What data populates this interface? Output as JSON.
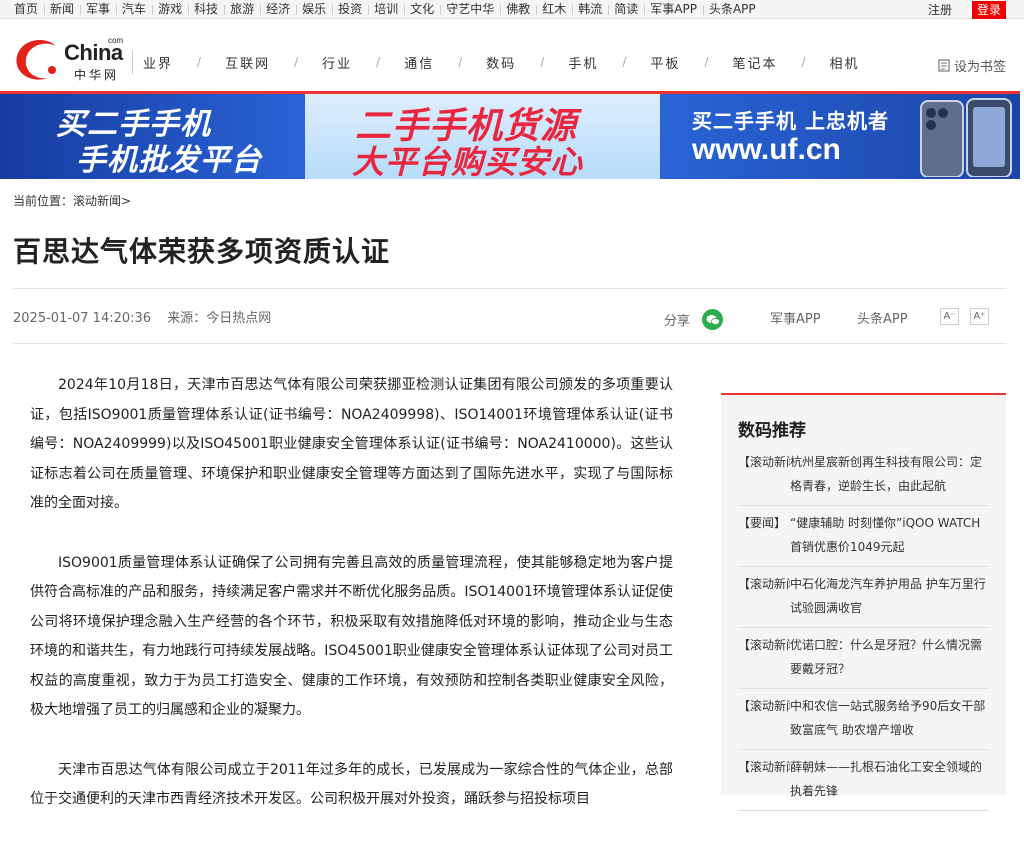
{
  "topbar": {
    "nav": [
      "首页",
      "新闻",
      "军事",
      "汽车",
      "游戏",
      "科技",
      "旅游",
      "经济",
      "娱乐",
      "投资",
      "培训",
      "文化",
      "守艺中华",
      "佛教",
      "红木",
      "韩流",
      "简读",
      "军事APP",
      "头条APP"
    ],
    "register": "注册",
    "login": "登录"
  },
  "header": {
    "logo_text": "China",
    "logo_com": "com",
    "logo_cn": "中华网",
    "nav": [
      "业界",
      "互联网",
      "行业",
      "通信",
      "数码",
      "手机",
      "平板",
      "笔记本",
      "相机"
    ],
    "bookmark": "设为书签"
  },
  "banner": {
    "left_line1": "买二手手机",
    "left_line2": "手机批发平台",
    "mid_line1": "二手手机货源",
    "mid_line2": "大平台购买安心",
    "right_line1": "买二手手机 上忠机者",
    "right_line2": "www.uf.cn"
  },
  "breadcrumb": "当前位置：滚动新闻>",
  "article": {
    "title": "百思达气体荣获多项资质认证",
    "date": "2025-01-07 14:20:36",
    "source": "来源：今日热点网",
    "share_label": "分享",
    "app1": "军事APP",
    "app2": "头条APP",
    "font_minus": "A⁻",
    "font_plus": "A⁺",
    "paragraphs": [
      "2024年10月18日，天津市百思达气体有限公司荣获挪亚检测认证集团有限公司颁发的多项重要认证，包括ISO9001质量管理体系认证(证书编号：NOA2409998)、ISO14001环境管理体系认证(证书编号：NOA2409999)以及ISO45001职业健康安全管理体系认证(证书编号：NOA2410000)。这些认证标志着公司在质量管理、环境保护和职业健康安全管理等方面达到了国际先进水平，实现了与国际标准的全面对接。",
      "ISO9001质量管理体系认证确保了公司拥有完善且高效的质量管理流程，使其能够稳定地为客户提供符合高标准的产品和服务，持续满足客户需求并不断优化服务品质。ISO14001环境管理体系认证促使公司将环境保护理念融入生产经营的各个环节，积极采取有效措施降低对环境的影响，推动企业与生态环境的和谐共生，有力地践行可持续发展战略。ISO45001职业健康安全管理体系认证体现了公司对员工权益的高度重视，致力于为员工打造安全、健康的工作环境，有效预防和控制各类职业健康安全风险，极大地增强了员工的归属感和企业的凝聚力。",
      "天津市百思达气体有限公司成立于2011年过多年的成长，已发展成为一家综合性的气体企业，总部位于交通便利的天津市西青经济技术开发区。公司积极开展对外投资，踊跃参与招投标项目"
    ]
  },
  "sidebar": {
    "title": "数码推荐",
    "items": [
      {
        "tag": "【滚动新闻】",
        "text": "杭州星宸新创再生科技有限公司：定格青春，逆龄生长，由此起航"
      },
      {
        "tag": "【要闻】",
        "text": "“健康辅助 时刻懂你”iQOO WATCH首销优惠价1049元起"
      },
      {
        "tag": "【滚动新闻】",
        "text": "中石化海龙汽车养护用品 护车万里行试验圆满收官"
      },
      {
        "tag": "【滚动新闻】",
        "text": "优诺口腔：什么是牙冠？什么情况需要戴牙冠？"
      },
      {
        "tag": "【滚动新闻】",
        "text": "中和农信一站式服务给予90后女干部致富底气 助农增产增收"
      },
      {
        "tag": "【滚动新闻】",
        "text": "薛朝妹——扎根石油化工安全领域的执着先锋"
      }
    ]
  }
}
